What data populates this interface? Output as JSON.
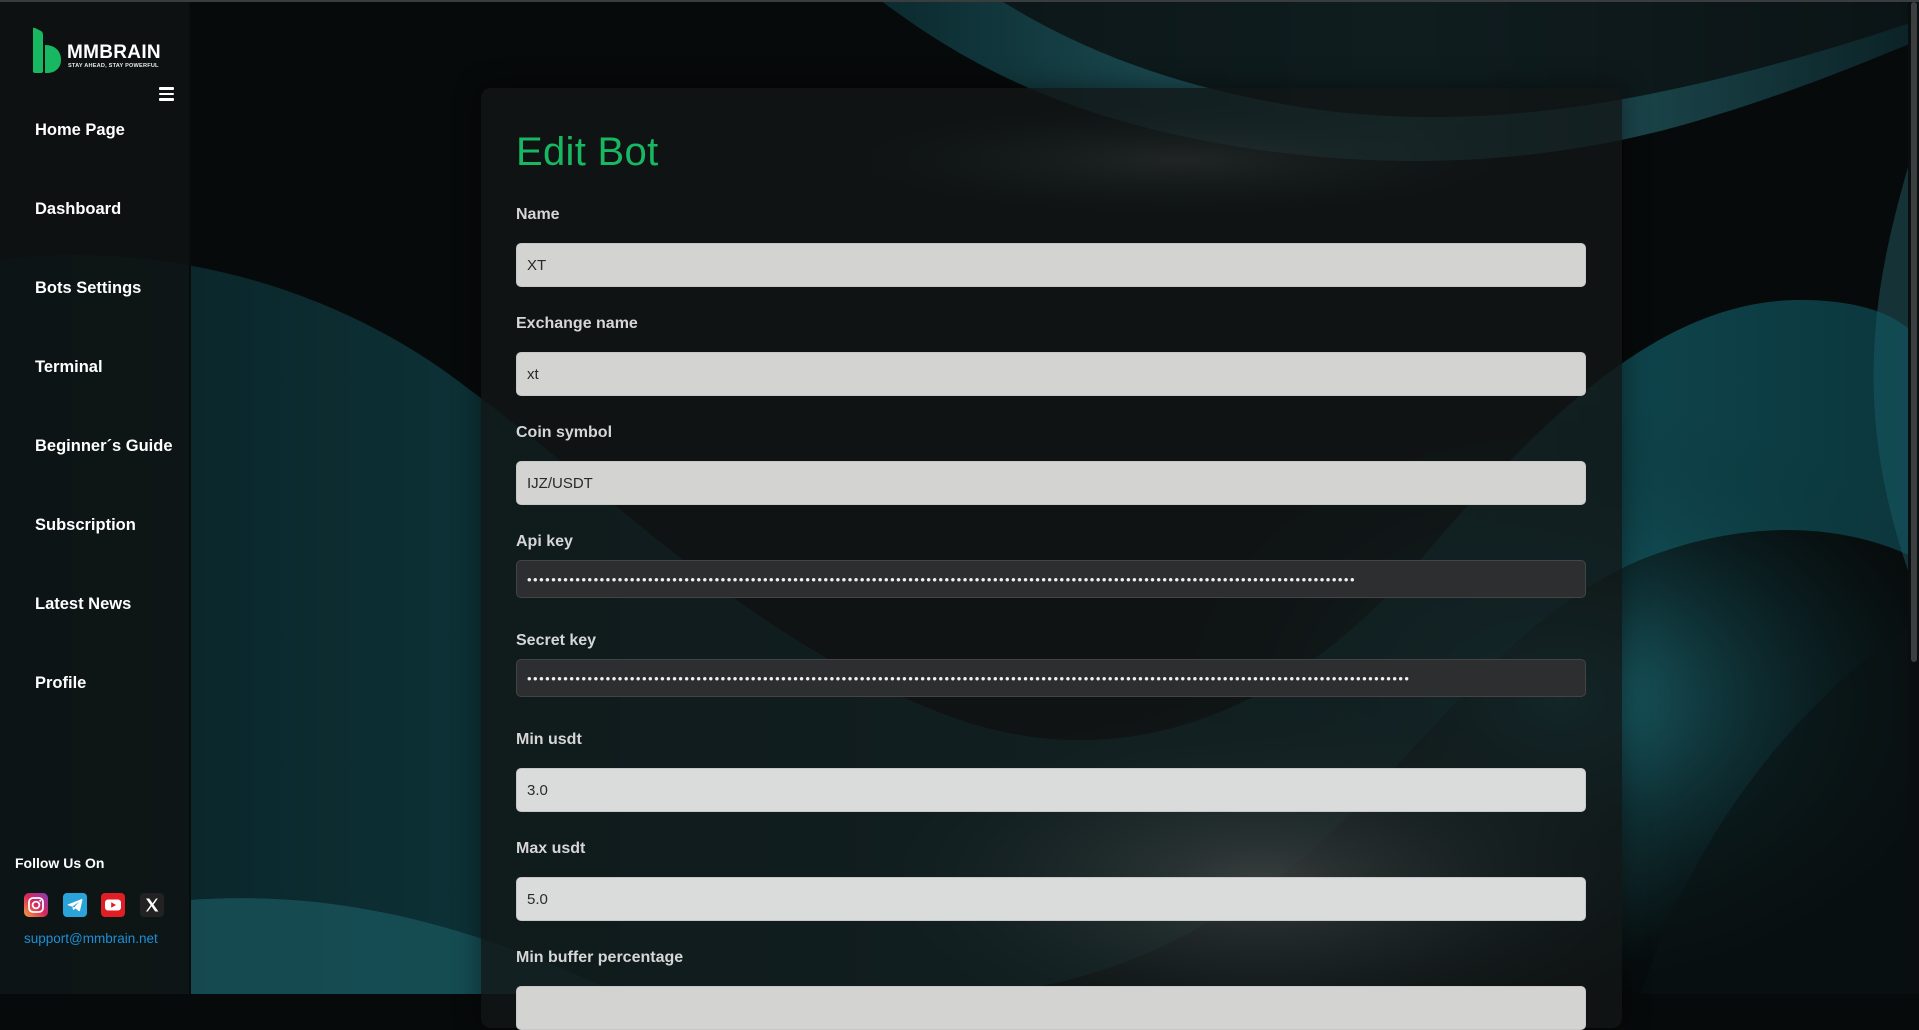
{
  "brand": {
    "name": "MMBRAIN",
    "tagline": "STAY AHEAD, STAY POWERFUL",
    "accent_color": "#18b862"
  },
  "sidebar": {
    "menu_icon": "hamburger-icon",
    "items": [
      {
        "label": "Home Page"
      },
      {
        "label": "Dashboard"
      },
      {
        "label": "Bots Settings"
      },
      {
        "label": "Terminal"
      },
      {
        "label": "Beginner´s Guide"
      },
      {
        "label": "Subscription"
      },
      {
        "label": "Latest News"
      },
      {
        "label": "Profile"
      }
    ],
    "follow_label": "Follow Us On",
    "socials": [
      {
        "icon": "instagram-icon",
        "color": "#d6285a"
      },
      {
        "icon": "telegram-icon",
        "color": "#2aa3d9"
      },
      {
        "icon": "youtube-icon",
        "color": "#e01e24"
      },
      {
        "icon": "x-icon",
        "color": "#222222"
      }
    ],
    "support_email": "support@mmbrain.net"
  },
  "form": {
    "title": "Edit Bot",
    "fields": [
      {
        "label": "Name",
        "value": "XT"
      },
      {
        "label": "Exchange name",
        "value": "xt"
      },
      {
        "label": "Coin symbol",
        "value": "IJZ/USDT"
      },
      {
        "label": "Api key",
        "value": "•••••••••••••••••••••••••••••••••••••••••••••••••••••••••••••••••••••••••••••••••••••••••••••••••••••••••••••••••••••••••••••••••••••••••"
      },
      {
        "label": "Secret key",
        "value": "••••••••••••••••••••••••••••••••••••••••••••••••••••••••••••••••••••••••••••••••••••••••••••••••••••••••••••••••••••••••••••••••••••••••••••••••••"
      },
      {
        "label": "Min usdt",
        "value": "3.0"
      },
      {
        "label": "Max usdt",
        "value": "5.0"
      },
      {
        "label": "Min buffer percentage",
        "value": ""
      }
    ]
  }
}
